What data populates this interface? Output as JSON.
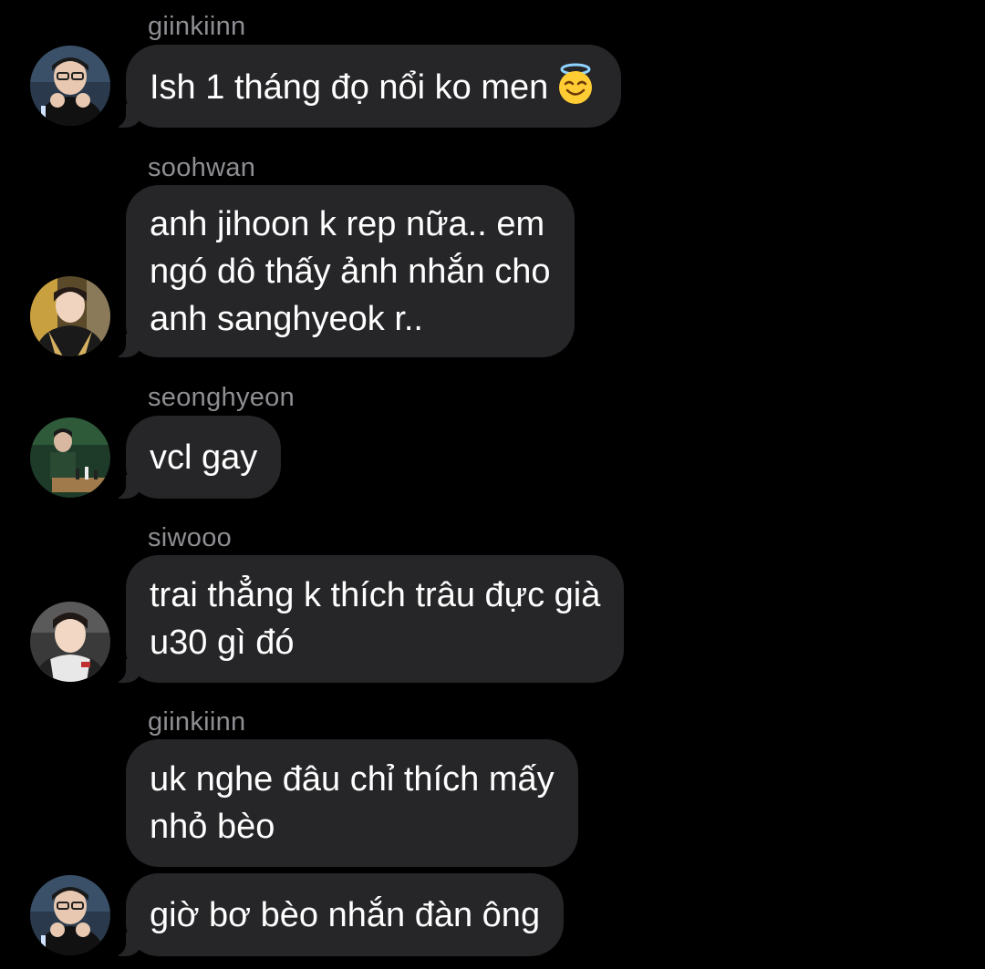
{
  "messages": [
    {
      "sender": "giinkiinn",
      "lines": [
        "Ish 1 tháng đọ nổi ko men"
      ],
      "emoji": "smiling-face-with-halo"
    },
    {
      "sender": "soohwan",
      "lines": [
        "anh jihoon k rep nữa.. em",
        "ngó dô thấy ảnh nhắn cho",
        "anh sanghyeok r.."
      ]
    },
    {
      "sender": "seonghyeon",
      "lines": [
        "vcl gay"
      ]
    },
    {
      "sender": "siwooo",
      "lines": [
        "trai thẳng k thích trâu đực già",
        "u30 gì đó"
      ]
    },
    {
      "sender": "giinkiinn",
      "lines": [
        "uk nghe đâu chỉ thích mấy",
        "nhỏ bèo"
      ]
    },
    {
      "lines": [
        "giờ bơ bèo nhắn đàn ông"
      ]
    }
  ],
  "colors": {
    "background": "#000000",
    "bubble": "#262628",
    "sender_name": "#8e8e93",
    "message_text": "#ffffff"
  },
  "icons": {
    "avatar": "profile-photo",
    "emoji": "smiling-face-with-halo"
  }
}
